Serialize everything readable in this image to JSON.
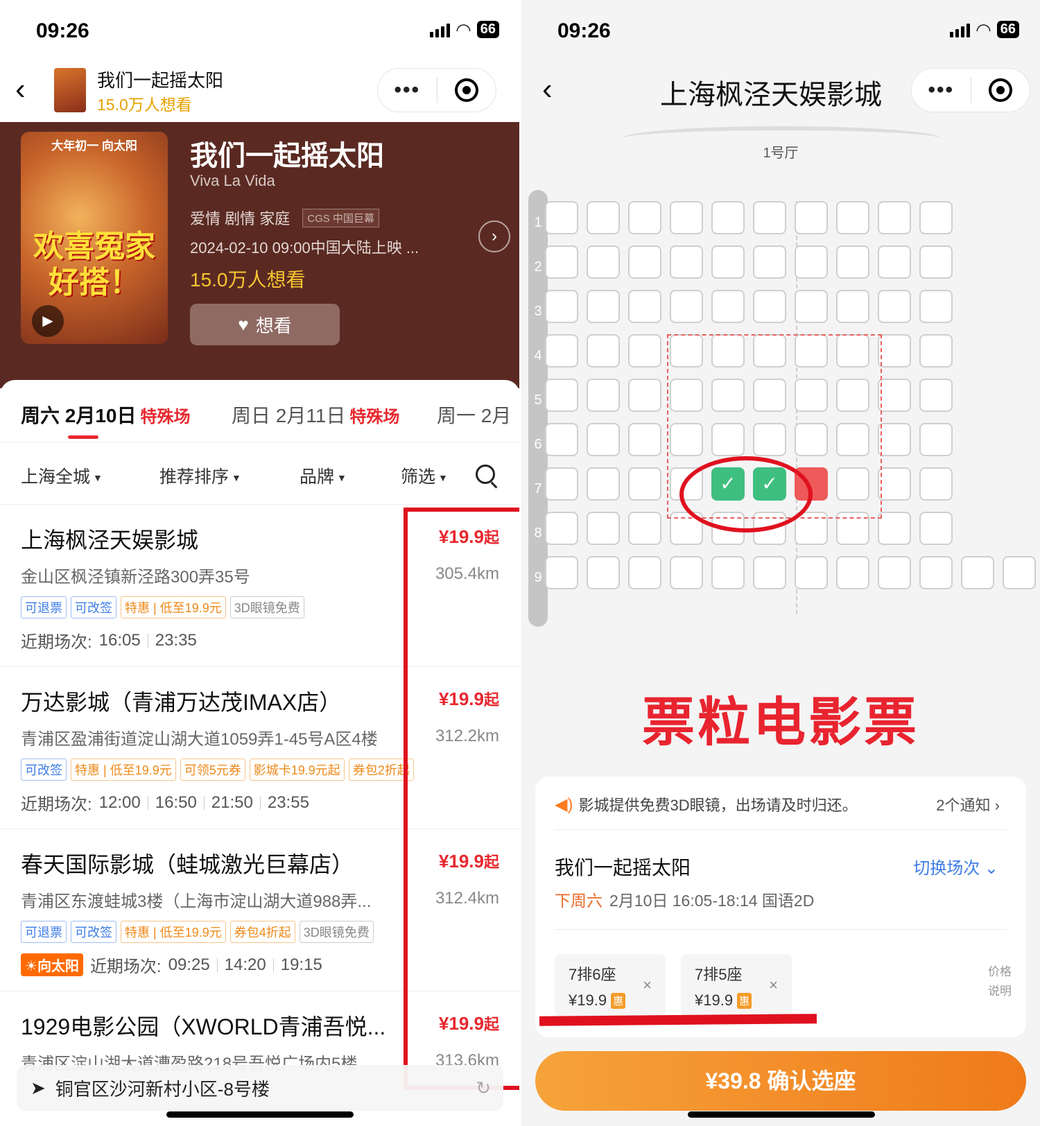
{
  "status": {
    "time": "09:26",
    "battery": "66"
  },
  "left": {
    "header": {
      "title": "我们一起摇太阳",
      "subtitle": "15.0万人想看"
    },
    "poster": {
      "top_text": "大年初一 向太阳",
      "big_text": "欢喜冤家好搭！"
    },
    "movie": {
      "title": "我们一起摇太阳",
      "english": "Viva La Vida",
      "genres": "爱情 剧情 家庭",
      "format": "CGS 中国巨幕",
      "release": "2024-02-10 09:00中国大陆上映 ...",
      "want_count": "15.0万人想看",
      "want_button": "想看"
    },
    "tabs": [
      {
        "label": "周六 2月10日",
        "special": "特殊场"
      },
      {
        "label": "周日 2月11日",
        "special": "特殊场"
      },
      {
        "label": "周一 2月",
        "special": ""
      }
    ],
    "filters": [
      "上海全城",
      "推荐排序",
      "品牌",
      "筛选"
    ],
    "cinemas": [
      {
        "name": "上海枫泾天娱影城",
        "address": "金山区枫泾镇新泾路300弄35号",
        "price": "¥19.9",
        "price_suffix": "起",
        "distance": "305.4km",
        "tags": [
          [
            "可退票",
            "blue"
          ],
          [
            "可改签",
            "blue"
          ],
          [
            "特惠 | 低至19.9元",
            "orange"
          ],
          [
            "3D眼镜免费",
            "gray"
          ]
        ],
        "badge": "",
        "times_label": "近期场次:",
        "times": [
          "16:05",
          "23:35"
        ]
      },
      {
        "name": "万达影城（青浦万达茂IMAX店）",
        "address": "青浦区盈浦街道淀山湖大道1059弄1-45号A区4楼",
        "price": "¥19.9",
        "price_suffix": "起",
        "distance": "312.2km",
        "tags": [
          [
            "可改签",
            "blue"
          ],
          [
            "特惠 | 低至19.9元",
            "orange"
          ],
          [
            "可领5元券",
            "orange"
          ],
          [
            "影城卡19.9元起",
            "orange"
          ],
          [
            "券包2折起",
            "orange"
          ]
        ],
        "badge": "",
        "times_label": "近期场次:",
        "times": [
          "12:00",
          "16:50",
          "21:50",
          "23:55"
        ]
      },
      {
        "name": "春天国际影城（蛙城激光巨幕店）",
        "address": "青浦区东渡蛙城3楼（上海市淀山湖大道988弄...",
        "price": "¥19.9",
        "price_suffix": "起",
        "distance": "312.4km",
        "tags": [
          [
            "可退票",
            "blue"
          ],
          [
            "可改签",
            "blue"
          ],
          [
            "特惠 | 低至19.9元",
            "orange"
          ],
          [
            "券包4折起",
            "orange"
          ],
          [
            "3D眼镜免费",
            "gray"
          ]
        ],
        "badge": "向太阳",
        "times_label": "近期场次:",
        "times": [
          "09:25",
          "14:20",
          "19:15"
        ]
      },
      {
        "name": "1929电影公园（XWORLD青浦吾悦...",
        "address": "青浦区淀山湖大道漕盈路218号吾悦广场内5楼",
        "price": "¥19.9",
        "price_suffix": "起",
        "distance": "313.6km",
        "tags": [],
        "badge": "",
        "times_label": "",
        "times": []
      }
    ],
    "location": "铜官区沙河新村小区-8号楼"
  },
  "right": {
    "header": {
      "title": "上海枫泾天娱影城"
    },
    "hall": "1号厅",
    "rows": [
      "1",
      "2",
      "3",
      "4",
      "5",
      "6",
      "7",
      "8",
      "9"
    ],
    "watermark": "票粒电影票",
    "notice": {
      "text": "影城提供免费3D眼镜，出场请及时归还。",
      "count": "2个通知"
    },
    "movie_title": "我们一起摇太阳",
    "switch_label": "切换场次",
    "session": {
      "day": "下周六",
      "detail": "2月10日 16:05-18:14 国语2D"
    },
    "selected_seats": [
      {
        "seat": "7排6座",
        "price": "¥19.9",
        "badge": "惠"
      },
      {
        "seat": "7排5座",
        "price": "¥19.9",
        "badge": "惠"
      }
    ],
    "price_note": "价格说明",
    "confirm": "¥39.8 确认选座"
  },
  "colors": {
    "accent_red": "#e8272e",
    "confirm_orange": "#f07a1a",
    "selected_green": "#3fbf7f",
    "hero_bg": "#5a2a22"
  }
}
